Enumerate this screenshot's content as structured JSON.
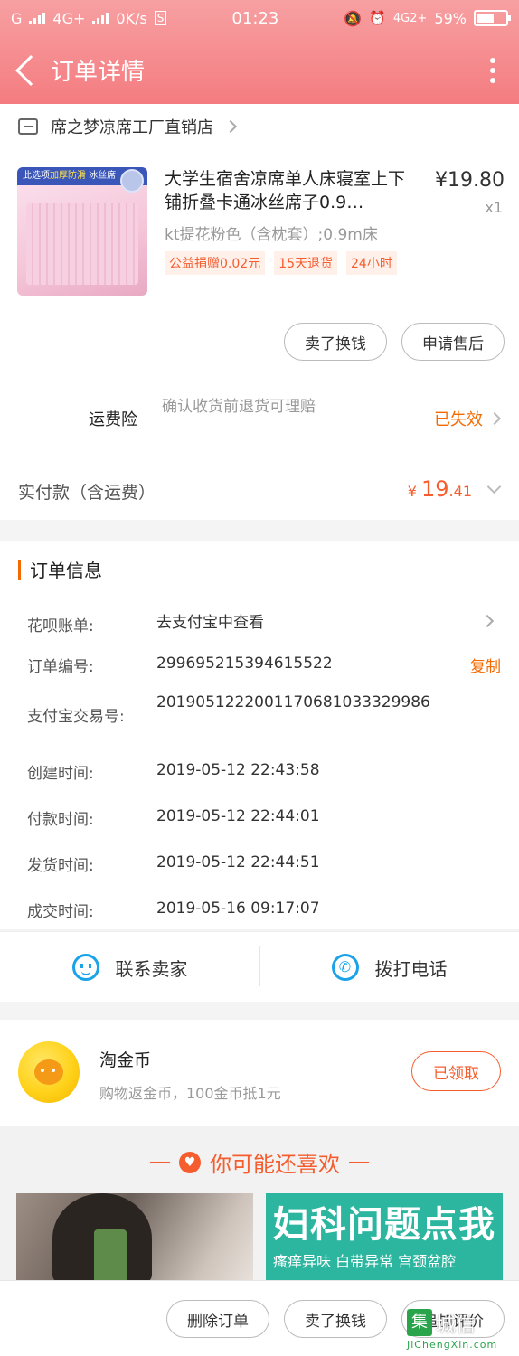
{
  "status_bar": {
    "network_left": "G",
    "network_4g": "4G+",
    "speed": "0K/s",
    "sim_badge": "S",
    "time": "01:23",
    "network_right": "4G2+",
    "battery": "59%",
    "battery_level": 0.59
  },
  "nav": {
    "title": "订单详情"
  },
  "shop": {
    "name": "席之梦凉席工厂直销店"
  },
  "product": {
    "image_band_prefix": "此选项",
    "image_band_highlight": "加厚防滑",
    "image_band_suffix": "冰丝席",
    "title": "大学生宿舍凉席单人床寝室上下铺折叠卡通冰丝席子0.9…",
    "price": "¥19.80",
    "qty": "x1",
    "sku": "kt提花粉色（含枕套）;0.9m床",
    "tags": [
      "公益捐赠0.02元",
      "15天退货",
      "24小时"
    ]
  },
  "product_actions": {
    "resell": "卖了换钱",
    "after_sale": "申请售后"
  },
  "freight_insurance": {
    "label": "运费险",
    "desc": "确认收货前退货可理赔",
    "status": "已失效"
  },
  "payment": {
    "label": "实付款（含运费）",
    "currency": "¥",
    "amount_int": "19",
    "amount_dec": ".41"
  },
  "order_info": {
    "heading": "订单信息",
    "rows": [
      {
        "key": "花呗账单:",
        "value": "去支付宝中查看"
      },
      {
        "key": "订单编号:",
        "value": "299695215394615522",
        "action": "复制"
      },
      {
        "key": "支付宝交易号:",
        "value": "2019051222001170681033329986"
      },
      {
        "key": "创建时间:",
        "value": "2019-05-12 22:43:58"
      },
      {
        "key": "付款时间:",
        "value": "2019-05-12 22:44:01"
      },
      {
        "key": "发货时间:",
        "value": "2019-05-12 22:44:51"
      },
      {
        "key": "成交时间:",
        "value": "2019-05-16 09:17:07"
      }
    ]
  },
  "contact": {
    "seller": "联系卖家",
    "phone": "拨打电话"
  },
  "coins": {
    "title": "淘金币",
    "subtitle": "购物返金币，100金币抵1元",
    "button": "已领取"
  },
  "recommend": {
    "title": "你可能还喜欢",
    "ad_big": "妇科问题点我",
    "ad_small": "瘙痒异味  白带异常  宫颈盆腔"
  },
  "bottom_actions": {
    "delete": "删除订单",
    "resell": "卖了换钱",
    "review": "追加评价"
  },
  "watermark": {
    "text": "城信",
    "url": "JiChengXin.com",
    "logo_char": "集"
  }
}
